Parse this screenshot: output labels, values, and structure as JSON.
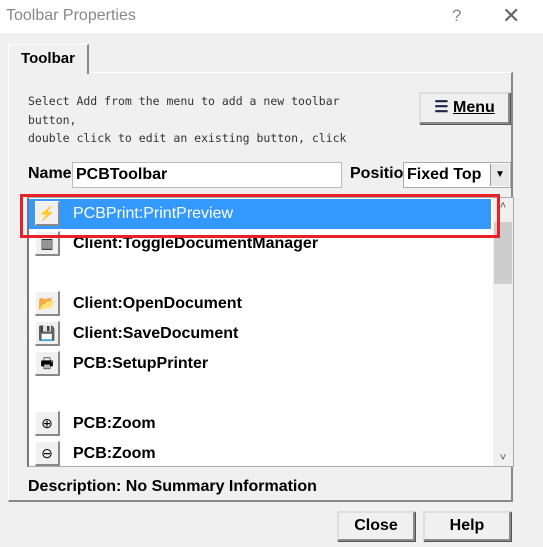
{
  "window": {
    "title": "Toolbar Properties",
    "help": "?",
    "close": "✕"
  },
  "tab": {
    "label": "Toolbar"
  },
  "instructions": "Select Add from the menu to add a new toolbar\nbutton,\ndouble click to edit an existing button, click",
  "menu_button": {
    "label": "Menu",
    "icon": "menu-list-icon"
  },
  "name": {
    "label": "Name",
    "value": "PCBToolbar"
  },
  "position": {
    "label": "Position",
    "value": "Fixed Top"
  },
  "list": {
    "items": [
      {
        "label": "PCBPrint:PrintPreview",
        "icon": "⚡",
        "selected": true
      },
      {
        "label": "Client:ToggleDocumentManager",
        "icon": "▥"
      },
      {
        "label": "",
        "separator": true
      },
      {
        "label": "Client:OpenDocument",
        "icon": "📂"
      },
      {
        "label": "Client:SaveDocument",
        "icon": "💾"
      },
      {
        "label": "PCB:SetupPrinter",
        "icon": "🖶"
      },
      {
        "label": "",
        "separator": true
      },
      {
        "label": "PCB:Zoom",
        "icon": "⊕"
      },
      {
        "label": "PCB:Zoom",
        "icon": "⊖"
      }
    ]
  },
  "description": "Description: No Summary Information",
  "buttons": {
    "close": "Close",
    "help": "Help"
  },
  "colors": {
    "selection": "#3399ff",
    "highlight_box": "#e8202a"
  }
}
